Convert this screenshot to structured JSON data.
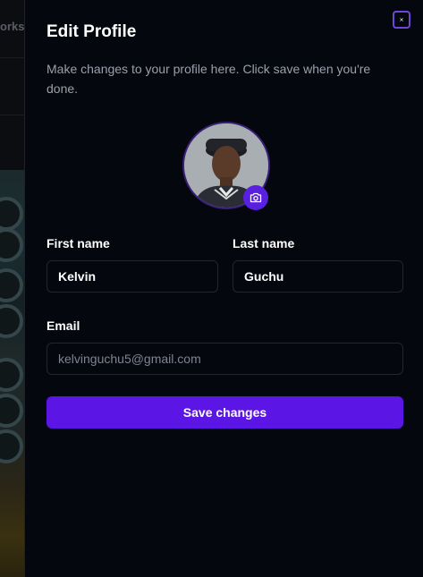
{
  "backdrop": {
    "partial_text": "orks"
  },
  "sheet": {
    "title": "Edit Profile",
    "description": "Make changes to your profile here. Click save when you're done.",
    "close_icon": "close-icon",
    "accent_color": "#5b16e6"
  },
  "avatar": {
    "camera_icon": "camera-icon"
  },
  "form": {
    "first_name_label": "First name",
    "first_name_value": "Kelvin",
    "last_name_label": "Last name",
    "last_name_value": "Guchu",
    "email_label": "Email",
    "email_placeholder": "kelvinguchu5@gmail.com",
    "save_label": "Save changes"
  }
}
